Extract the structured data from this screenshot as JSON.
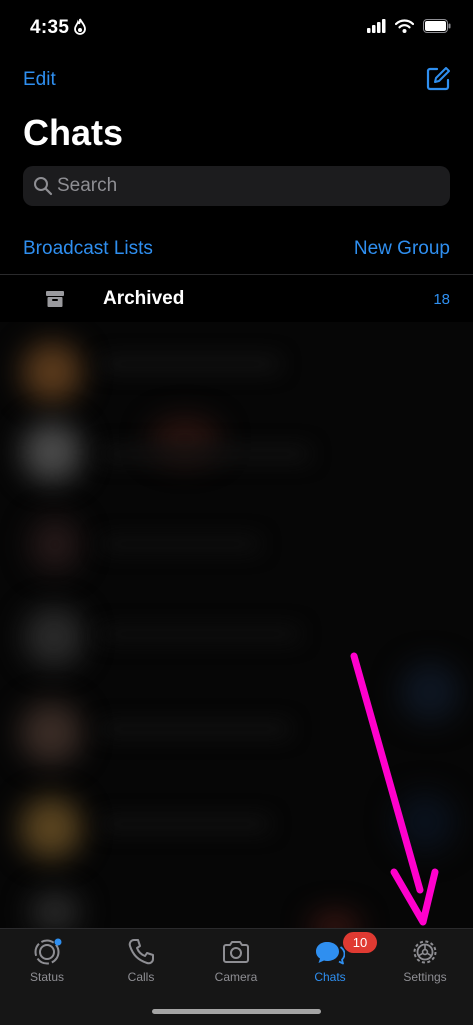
{
  "status_bar": {
    "time": "4:35"
  },
  "header": {
    "edit_label": "Edit",
    "title": "Chats"
  },
  "search": {
    "placeholder": "Search"
  },
  "links": {
    "broadcast": "Broadcast Lists",
    "new_group": "New Group"
  },
  "archived": {
    "label": "Archived",
    "count": "18"
  },
  "tab_bar": {
    "tabs": [
      {
        "label": "Status",
        "icon": "status-icon"
      },
      {
        "label": "Calls",
        "icon": "phone-icon"
      },
      {
        "label": "Camera",
        "icon": "camera-icon"
      },
      {
        "label": "Chats",
        "icon": "chat-bubbles-icon",
        "active": true
      },
      {
        "label": "Settings",
        "icon": "gear-icon"
      }
    ],
    "chats_badge": "10"
  },
  "colors": {
    "accent": "#2f8ff0",
    "badge": "#e03a32",
    "annotation_arrow": "#ff00cc",
    "background": "#000000"
  }
}
